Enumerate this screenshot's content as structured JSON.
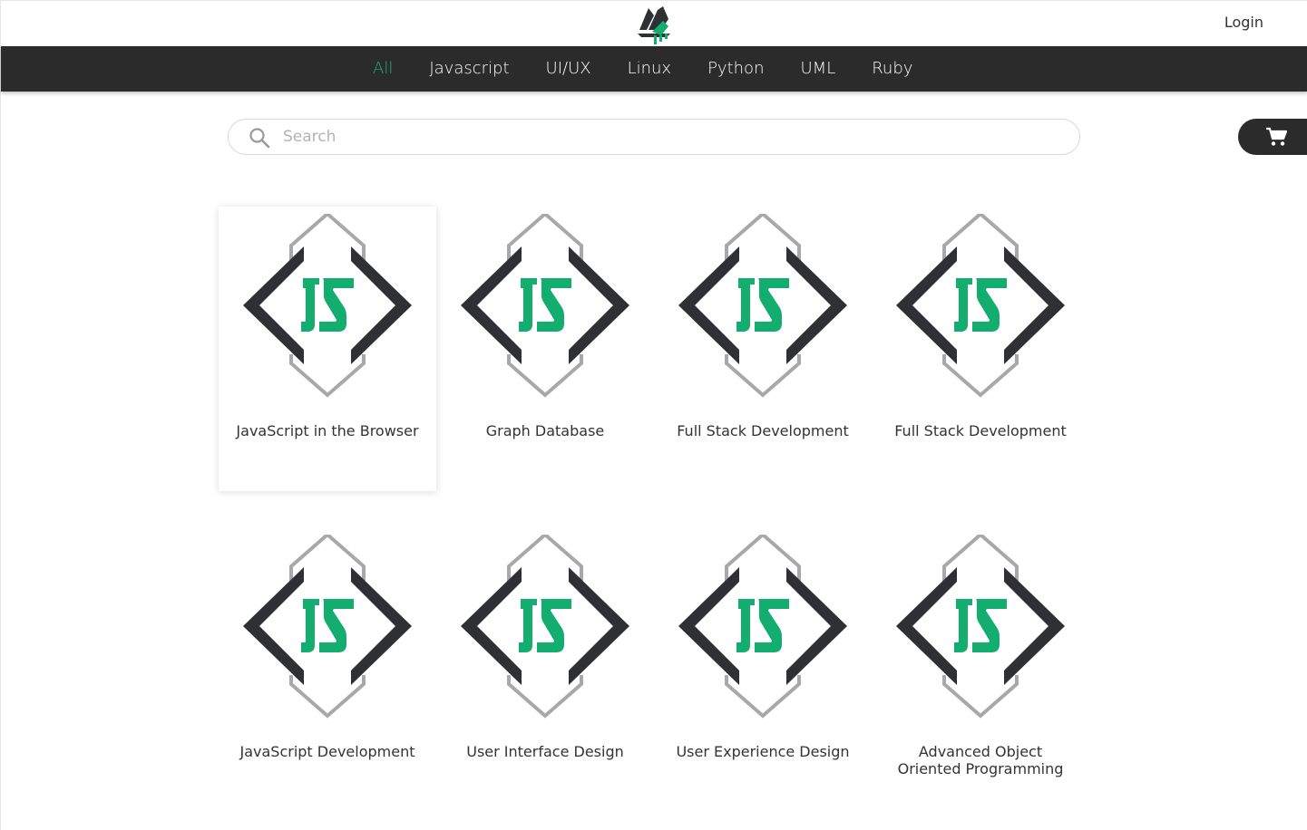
{
  "header": {
    "logo_icon": "leaf-logo-icon",
    "login_label": "Login"
  },
  "categories": [
    {
      "label": "All",
      "active": true
    },
    {
      "label": "Javascript",
      "active": false
    },
    {
      "label": "UI/UX",
      "active": false
    },
    {
      "label": "Linux",
      "active": false
    },
    {
      "label": "Python",
      "active": false
    },
    {
      "label": "UML",
      "active": false
    },
    {
      "label": "Ruby",
      "active": false
    }
  ],
  "search": {
    "placeholder": "Search",
    "value": "",
    "icon": "search-icon"
  },
  "cart": {
    "icon": "cart-icon"
  },
  "courses": [
    {
      "title": "JavaScript in the Browser",
      "icon": "js-diamond-icon",
      "highlighted": true
    },
    {
      "title": "Graph Database",
      "icon": "js-diamond-icon",
      "highlighted": false
    },
    {
      "title": "Full Stack Development",
      "icon": "js-diamond-icon",
      "highlighted": false
    },
    {
      "title": "Full Stack Development",
      "icon": "js-diamond-icon",
      "highlighted": false
    },
    {
      "title": "JavaScript Development",
      "icon": "js-diamond-icon",
      "highlighted": false
    },
    {
      "title": "User Interface Design",
      "icon": "js-diamond-icon",
      "highlighted": false
    },
    {
      "title": "User Experience Design",
      "icon": "js-diamond-icon",
      "highlighted": false
    },
    {
      "title": "Advanced Object Oriented Programming",
      "icon": "js-diamond-icon",
      "highlighted": false
    }
  ],
  "colors": {
    "accent": "#1bb37a",
    "nav_bg": "#2b2b2b",
    "icon_dark": "#2e3033",
    "icon_outline": "#a8a8a8",
    "icon_green": "#13ad6f"
  }
}
